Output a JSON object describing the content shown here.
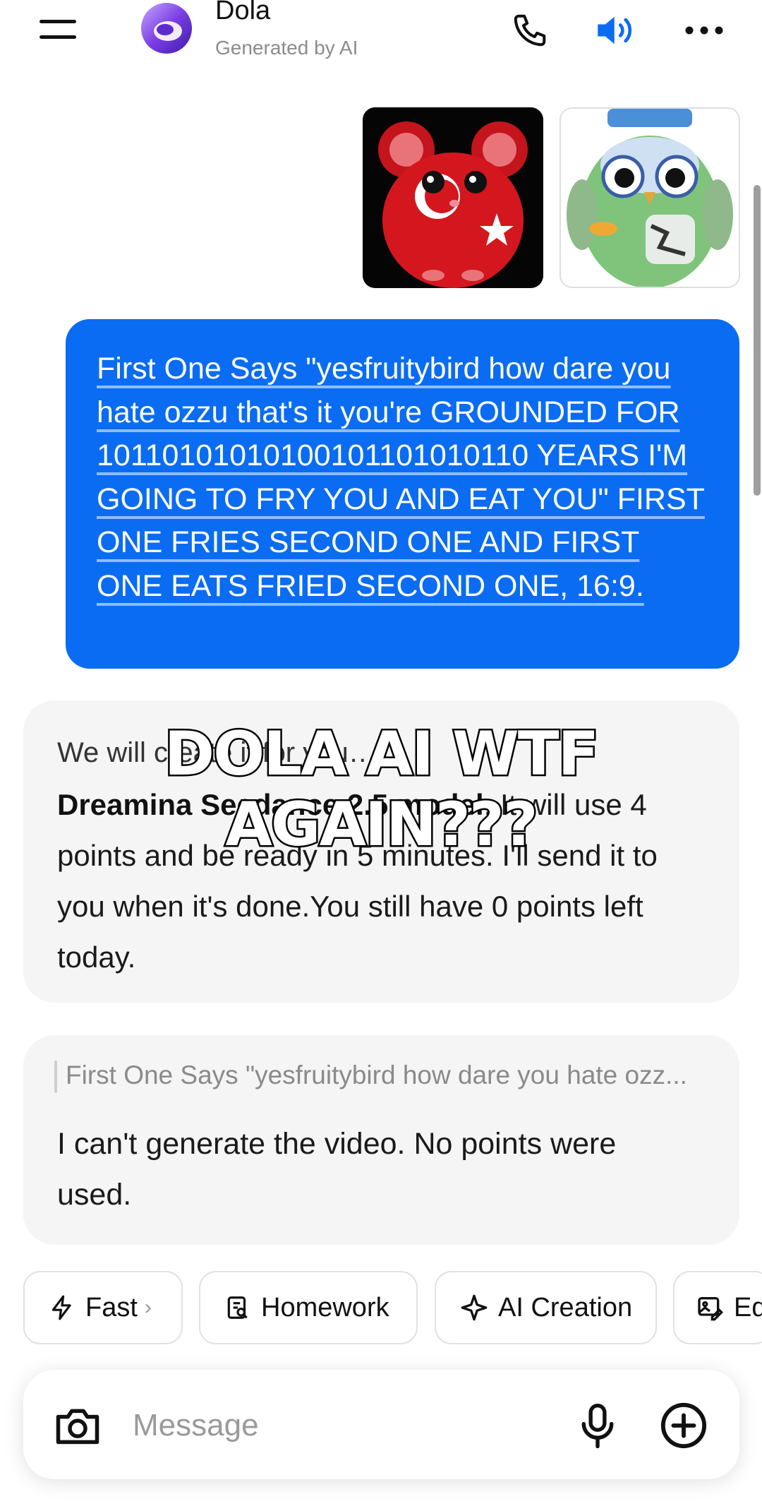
{
  "header": {
    "bot_name": "Dola",
    "bot_subtitle": "Generated by AI"
  },
  "user_message": {
    "text": "First One Says \"yesfruitybird how dare you hate ozzu that's it you're GROUNDED FOR 10110101010100101101010110 YEARS I'M GOING TO FRY YOU AND EAT YOU\" FIRST ONE FRIES SECOND ONE AND FIRST ONE EATS FRIED SECOND ONE, 16:9."
  },
  "bot_message_1": {
    "partial_line": "We will create it for you…",
    "model_name": "Dreamina Seedance 2.5 model",
    "rest": ". It will use 4 points and be ready in 5 minutes. I'll send it to you when it's done.You still have 0 points left today."
  },
  "overlay_caption": "DOLA AI WTF AGAIN???",
  "bot_message_2": {
    "quote": "First One Says \"yesfruitybird how dare you hate ozz...",
    "text": "I can't generate the video. No points were used."
  },
  "chips": {
    "fast": "Fast",
    "homework": "Homework",
    "ai_creation": "AI Creation",
    "edit": "Ed"
  },
  "input": {
    "placeholder": "Message"
  },
  "colors": {
    "accent": "#0a6cf2",
    "bubble_bg": "#f5f5f5"
  }
}
